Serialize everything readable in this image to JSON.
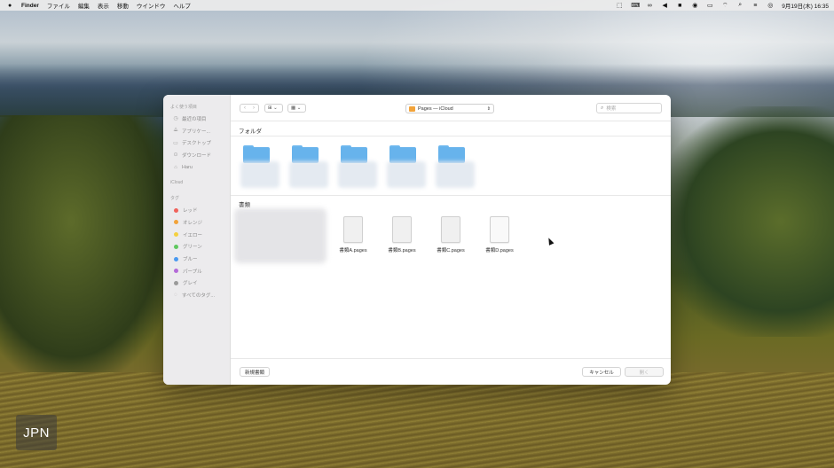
{
  "menubar": {
    "app_name": "Finder",
    "menus": [
      "ファイル",
      "編集",
      "表示",
      "移動",
      "ウインドウ",
      "ヘルプ"
    ],
    "status_icons": [
      "cursor-icon",
      "keyboard-icon",
      "glasses-icon",
      "volume-icon",
      "text-input-icon",
      "account-icon",
      "battery-icon",
      "wifi-icon",
      "search-icon",
      "control-center-icon",
      "siri-icon"
    ],
    "clock": "9月19日(木)  16:35"
  },
  "sidebar": {
    "favorites_heading": "よく使う項目",
    "favorites": [
      {
        "icon": "clock-icon",
        "label": "最近の項目"
      },
      {
        "icon": "apps-icon",
        "label": "アプリケー..."
      },
      {
        "icon": "desktop-icon",
        "label": "デスクトップ"
      },
      {
        "icon": "download-icon",
        "label": "ダウンロード"
      },
      {
        "icon": "home-icon",
        "label": "Haru"
      }
    ],
    "icloud_heading": "iCloud",
    "tags_heading": "タグ",
    "tags": [
      {
        "color": "#f0625b",
        "label": "レッド"
      },
      {
        "color": "#f2a33a",
        "label": "オレンジ"
      },
      {
        "color": "#f4d03f",
        "label": "イエロー"
      },
      {
        "color": "#5fc85f",
        "label": "グリーン"
      },
      {
        "color": "#4a9af0",
        "label": "ブルー"
      },
      {
        "color": "#b46ad8",
        "label": "パープル"
      },
      {
        "color": "#9a9a9a",
        "label": "グレイ"
      },
      {
        "color": "",
        "label": "すべてのタグ..."
      }
    ]
  },
  "toolbar": {
    "back": "‹",
    "forward": "›",
    "location": "Pages — iCloud",
    "search_placeholder": "検索"
  },
  "folders_section": {
    "title": "フォルダ",
    "count": 5
  },
  "documents_section": {
    "title": "書類",
    "documents": [
      "書類A.pages",
      "書類B.pages",
      "書類C.pages",
      "書類D.pages"
    ]
  },
  "footer": {
    "new_document": "新規書類",
    "cancel": "キャンセル",
    "open": "開く"
  },
  "badge": "JPN",
  "colors": {
    "folder_blue": "#67b3ec",
    "sidebar_bg": "#ecebed"
  }
}
